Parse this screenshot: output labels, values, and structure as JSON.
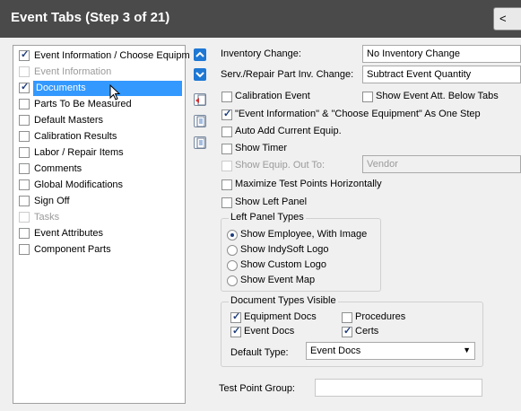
{
  "window": {
    "title": "Event Tabs (Step 3 of 21)",
    "back_label": "<"
  },
  "left_panel": {
    "items": [
      {
        "label": "Event Information / Choose Equipm",
        "checked": true,
        "disabled": false,
        "selected": false
      },
      {
        "label": "Event Information",
        "checked": false,
        "disabled": true,
        "selected": false
      },
      {
        "label": "Documents",
        "checked": true,
        "disabled": false,
        "selected": true
      },
      {
        "label": "Parts To Be Measured",
        "checked": false,
        "disabled": false,
        "selected": false
      },
      {
        "label": "Default Masters",
        "checked": false,
        "disabled": false,
        "selected": false
      },
      {
        "label": "Calibration Results",
        "checked": false,
        "disabled": false,
        "selected": false
      },
      {
        "label": "Labor / Repair Items",
        "checked": false,
        "disabled": false,
        "selected": false
      },
      {
        "label": "Comments",
        "checked": false,
        "disabled": false,
        "selected": false
      },
      {
        "label": "Global Modifications",
        "checked": false,
        "disabled": false,
        "selected": false
      },
      {
        "label": "Sign Off",
        "checked": false,
        "disabled": false,
        "selected": false
      },
      {
        "label": "Tasks",
        "checked": false,
        "disabled": true,
        "selected": false
      },
      {
        "label": "Event Attributes",
        "checked": false,
        "disabled": false,
        "selected": false
      },
      {
        "label": "Component Parts",
        "checked": false,
        "disabled": false,
        "selected": false
      }
    ]
  },
  "fields": {
    "inventory_change_label": "Inventory Change:",
    "inventory_change_value": "No Inventory Change",
    "serv_repair_label": "Serv./Repair Part Inv. Change:",
    "serv_repair_value": "Subtract Event Quantity",
    "show_equip_out_to_value": "Vendor",
    "test_point_group_label": "Test Point Group:",
    "test_point_group_value": ""
  },
  "options": {
    "calibration_event": "Calibration Event",
    "show_event_att": "Show Event Att. Below Tabs",
    "event_info_one_step": "\"Event Information\" & \"Choose Equipment\" As One Step",
    "auto_add_equip": "Auto Add Current Equip.",
    "show_timer": "Show Timer",
    "show_equip_out_to": "Show Equip. Out To:",
    "maximize_test_points": "Maximize Test Points Horizontally",
    "show_left_panel": "Show Left Panel"
  },
  "left_panel_types": {
    "title": "Left Panel Types",
    "options": [
      {
        "label": "Show Employee, With Image",
        "selected": true
      },
      {
        "label": "Show IndySoft Logo",
        "selected": false
      },
      {
        "label": "Show Custom Logo",
        "selected": false
      },
      {
        "label": "Show Event Map",
        "selected": false
      }
    ]
  },
  "document_types": {
    "title": "Document Types Visible",
    "equipment_docs": "Equipment Docs",
    "procedures": "Procedures",
    "event_docs": "Event Docs",
    "certs": "Certs",
    "default_type_label": "Default Type:",
    "default_type_value": "Event Docs"
  },
  "colors": {
    "selection": "#3399ff",
    "titlebar": "#4a4a4a",
    "accent_blue": "#1e78d4"
  }
}
